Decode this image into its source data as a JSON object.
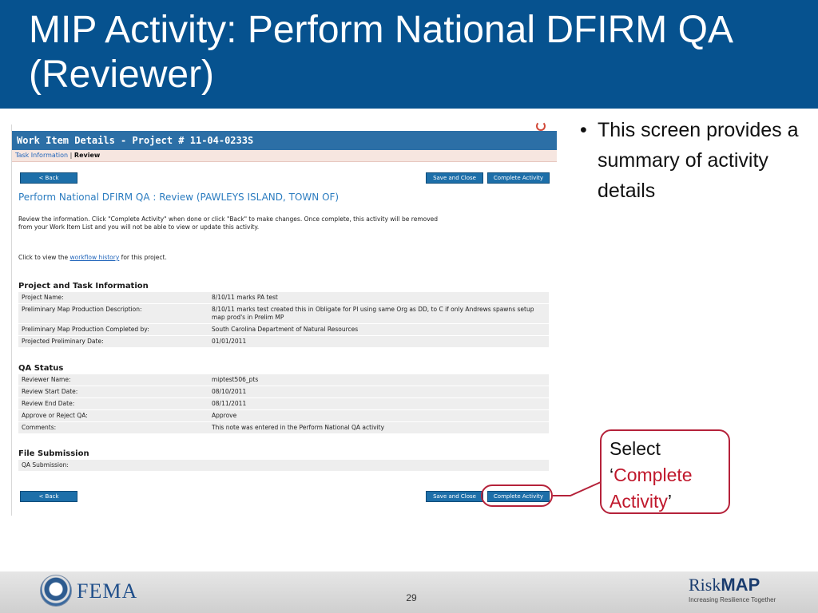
{
  "slide": {
    "title": "MIP Activity: Perform National DFIRM QA (Reviewer)",
    "page_number": "29"
  },
  "screenshot": {
    "header": "Work Item Details - Project # 11-04-0233S",
    "breadcrumb": {
      "task_info": "Task Information",
      "separator": "|",
      "current": "Review"
    },
    "buttons": {
      "back": "< Back",
      "save_close": "Save and Close",
      "complete": "Complete Activity"
    },
    "heading": "Perform National DFIRM QA : Review (PAWLEYS ISLAND, TOWN OF)",
    "instructions_line1": "Review the information. Click \"Complete Activity\" when done or click \"Back\" to make changes. Once complete, this activity will be removed",
    "instructions_line2": "from your Work Item List and you will not be able to view or update this activity.",
    "workflow_prefix": "Click to view the ",
    "workflow_link": "workflow history",
    "workflow_suffix": " for this project.",
    "sections": {
      "project": {
        "title": "Project and Task Information",
        "rows": [
          {
            "label": "Project Name:",
            "value": "8/10/11 marks PA test"
          },
          {
            "label": "Preliminary Map Production Description:",
            "value": "8/10/11 marks test created this in Obligate for PI using same Org as DD, to C if only Andrews spawns setup map prod's in Prelim MP"
          },
          {
            "label": "Preliminary Map Production Completed by:",
            "value": "South Carolina Department of Natural Resources"
          },
          {
            "label": "Projected Preliminary Date:",
            "value": "01/01/2011"
          }
        ]
      },
      "qa": {
        "title": "QA Status",
        "rows": [
          {
            "label": "Reviewer Name:",
            "value": "miptest506_pts"
          },
          {
            "label": "Review Start Date:",
            "value": "08/10/2011"
          },
          {
            "label": "Review End Date:",
            "value": "08/11/2011"
          },
          {
            "label": "Approve or Reject QA:",
            "value": "Approve"
          },
          {
            "label": "Comments:",
            "value": "This note was entered in the Perform National QA activity"
          }
        ]
      },
      "file": {
        "title": "File Submission",
        "rows": [
          {
            "label": "QA Submission:",
            "value": ""
          }
        ]
      }
    }
  },
  "bullets": [
    "This screen provides a summary of activity details"
  ],
  "callout": {
    "select": "Select",
    "open_quote": "‘",
    "highlight": "Complete Activity",
    "close_quote": "’"
  },
  "footer": {
    "fema": "FEMA",
    "riskmap_risk": "Risk",
    "riskmap_map": "MAP",
    "tagline": "Increasing Resilience Together"
  },
  "colors": {
    "title_bar": "#06528f",
    "accent_red": "#b5223a",
    "button_blue": "#1d6fa9"
  }
}
